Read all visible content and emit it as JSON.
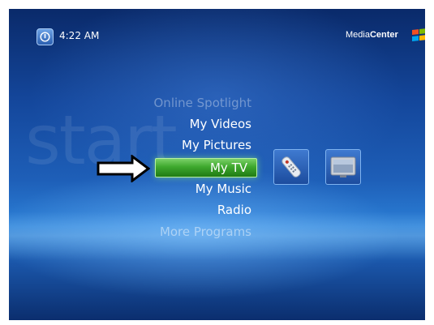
{
  "header": {
    "time": "4:22 AM",
    "brand_light": "Media",
    "brand_bold": "Center"
  },
  "background_word": "start",
  "menu": {
    "items": [
      {
        "label": "Online Spotlight",
        "state": "faded"
      },
      {
        "label": "My Videos",
        "state": "normal"
      },
      {
        "label": "My Pictures",
        "state": "normal"
      },
      {
        "label": "My TV",
        "state": "selected"
      },
      {
        "label": "My Music",
        "state": "normal"
      },
      {
        "label": "Radio",
        "state": "normal"
      },
      {
        "label": "More Programs",
        "state": "faded"
      }
    ]
  },
  "tiles": [
    {
      "icon": "remote-control-icon"
    },
    {
      "icon": "tv-monitor-icon"
    }
  ],
  "colors": {
    "background_top": "#0a2a6a",
    "background_mid": "#2b7fd6",
    "selected_green": "#3ea82d",
    "text": "#ffffff"
  }
}
